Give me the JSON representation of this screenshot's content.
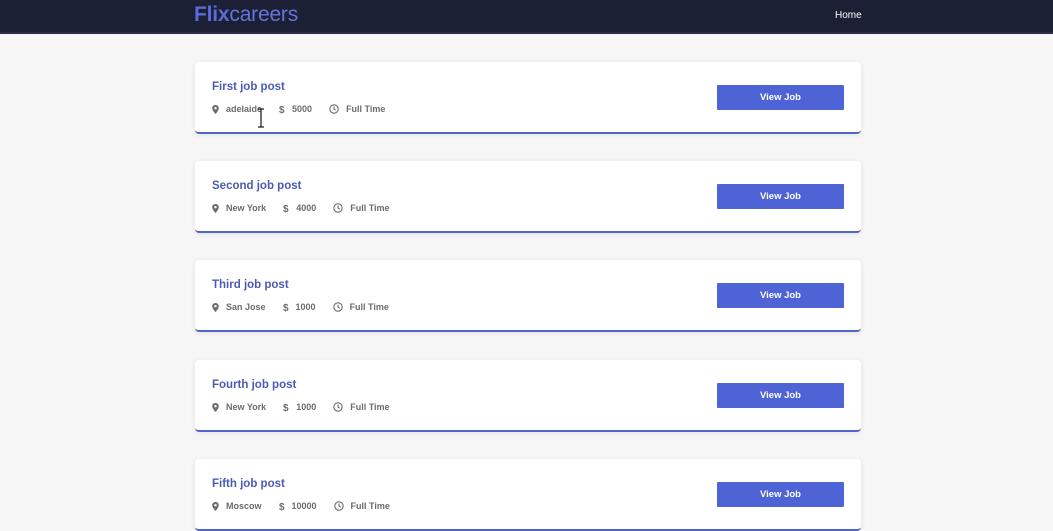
{
  "brand": {
    "bold": "Flix",
    "light": "careers"
  },
  "nav": {
    "home": "Home"
  },
  "jobs": [
    {
      "title": "First job post",
      "location": "adelaide",
      "salary": "5000",
      "type": "Full Time",
      "button": "View Job"
    },
    {
      "title": "Second job post",
      "location": "New York",
      "salary": "4000",
      "type": "Full Time",
      "button": "View Job"
    },
    {
      "title": "Third job post",
      "location": "San Jose",
      "salary": "1000",
      "type": "Full Time",
      "button": "View Job"
    },
    {
      "title": "Fourth job post",
      "location": "New York",
      "salary": "1000",
      "type": "Full Time",
      "button": "View Job"
    },
    {
      "title": "Fifth job post",
      "location": "Moscow",
      "salary": "10000",
      "type": "Full Time",
      "button": "View Job"
    }
  ],
  "icons": {
    "location": "map-pin-icon",
    "salary": "dollar-icon",
    "type": "clock-icon"
  },
  "colors": {
    "navbar": "#1c2035",
    "brand": "#5b6bd8",
    "title": "#4a5bb3",
    "button": "#4e63d6",
    "card_border": "#5364c8"
  }
}
